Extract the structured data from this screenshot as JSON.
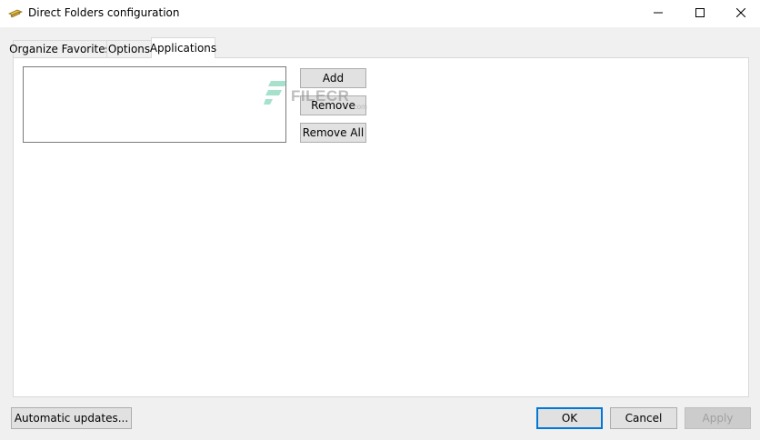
{
  "window": {
    "title": "Direct Folders configuration",
    "app_icon": "folder-arrow-icon"
  },
  "caption": {
    "minimize_icon": "minimize-icon",
    "maximize_icon": "maximize-icon",
    "close_icon": "close-icon"
  },
  "tabs": [
    {
      "label": "Organize Favorites",
      "selected": false
    },
    {
      "label": "Options",
      "selected": false
    },
    {
      "label": "Applications",
      "selected": true
    }
  ],
  "applications": {
    "list_items": [],
    "add_label": "Add",
    "remove_label": "Remove",
    "remove_all_label": "Remove All"
  },
  "footer": {
    "auto_updates_label": "Automatic updates...",
    "ok_label": "OK",
    "cancel_label": "Cancel",
    "apply_label": "Apply",
    "apply_disabled": true
  },
  "watermark": {
    "text": "FILECR",
    "sub": ".com"
  },
  "colors": {
    "focus_border": "#0078d7",
    "button_bg": "#e1e1e1",
    "panel_bg": "#ffffff",
    "window_bg": "#f0f0f0",
    "watermark_green": "#5fc9a2"
  }
}
